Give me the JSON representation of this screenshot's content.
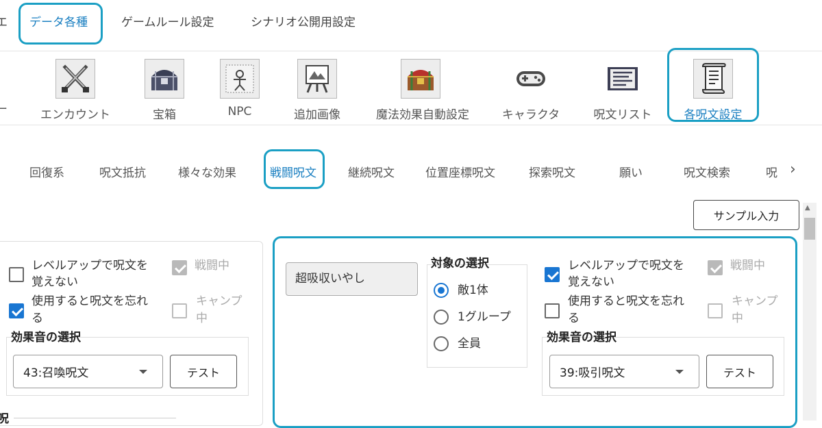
{
  "top_tabs": [
    {
      "label": "データ各種"
    },
    {
      "label": "ゲームルール設定"
    },
    {
      "label": "シナリオ公開用設定"
    }
  ],
  "top_left_fragment": "エ",
  "toolbar": {
    "left_fragment": "ー",
    "items": [
      {
        "label": "エンカウント",
        "icon": "crossed-swords-icon"
      },
      {
        "label": "宝箱",
        "icon": "treasure-chest-icon"
      },
      {
        "label": "NPC",
        "icon": "npc-figure-icon"
      },
      {
        "label": "追加画像",
        "icon": "image-easel-icon"
      },
      {
        "label": "魔法効果自動設定",
        "icon": "red-chest-icon"
      },
      {
        "label": "キャラクタ",
        "icon": "gamepad-icon"
      },
      {
        "label": "呪文リスト",
        "icon": "spell-list-icon"
      },
      {
        "label": "各呪文設定",
        "icon": "scroll-icon"
      }
    ]
  },
  "sub_tabs": [
    {
      "label": "回復系"
    },
    {
      "label": "呪文抵抗"
    },
    {
      "label": "様々な効果"
    },
    {
      "label": "戦闘呪文"
    },
    {
      "label": "継続呪文"
    },
    {
      "label": "位置座標呪文"
    },
    {
      "label": "探索呪文"
    },
    {
      "label": "願い"
    },
    {
      "label": "呪文検索"
    },
    {
      "label": "呪"
    }
  ],
  "sample_input_label": "サンプル入力",
  "left_panel": {
    "levelup_label": "レベルアップで呪文を覚えない",
    "levelup_line1": "レベルアップで呪文を",
    "levelup_line2": "覚えない",
    "levelup_checked": false,
    "battle_label": "戦闘中",
    "battle_checked": true,
    "forget_line1": "使用すると呪文を忘れ",
    "forget_line2": "る",
    "forget_checked": true,
    "camp_line1": "キャンプ",
    "camp_line2": "中",
    "camp_checked": false,
    "sound_title": "効果音の選択",
    "sound_value": "43:召喚呪文",
    "test_label": "テスト",
    "bottom_fragment": "呪"
  },
  "right_panel": {
    "spell_name": "超吸収いやし",
    "target_title": "対象の選択",
    "target_options": [
      {
        "label": "敵1体",
        "selected": true
      },
      {
        "label": "1グループ",
        "selected": false
      },
      {
        "label": "全員",
        "selected": false
      }
    ],
    "levelup_line1": "レベルアップで呪文を",
    "levelup_line2": "覚えない",
    "levelup_checked": true,
    "battle_label": "戦闘中",
    "battle_checked": true,
    "forget_line1": "使用すると呪文を忘れ",
    "forget_line2": "る",
    "forget_checked": false,
    "camp_line1": "キャンプ",
    "camp_line2": "中",
    "camp_checked": false,
    "sound_title": "効果音の選択",
    "sound_value": "39:吸引呪文",
    "test_label": "テスト"
  },
  "colors": {
    "accent": "#1a7fc1",
    "highlight_border": "#1a9fc4",
    "checkbox_checked": "#1976d2"
  }
}
